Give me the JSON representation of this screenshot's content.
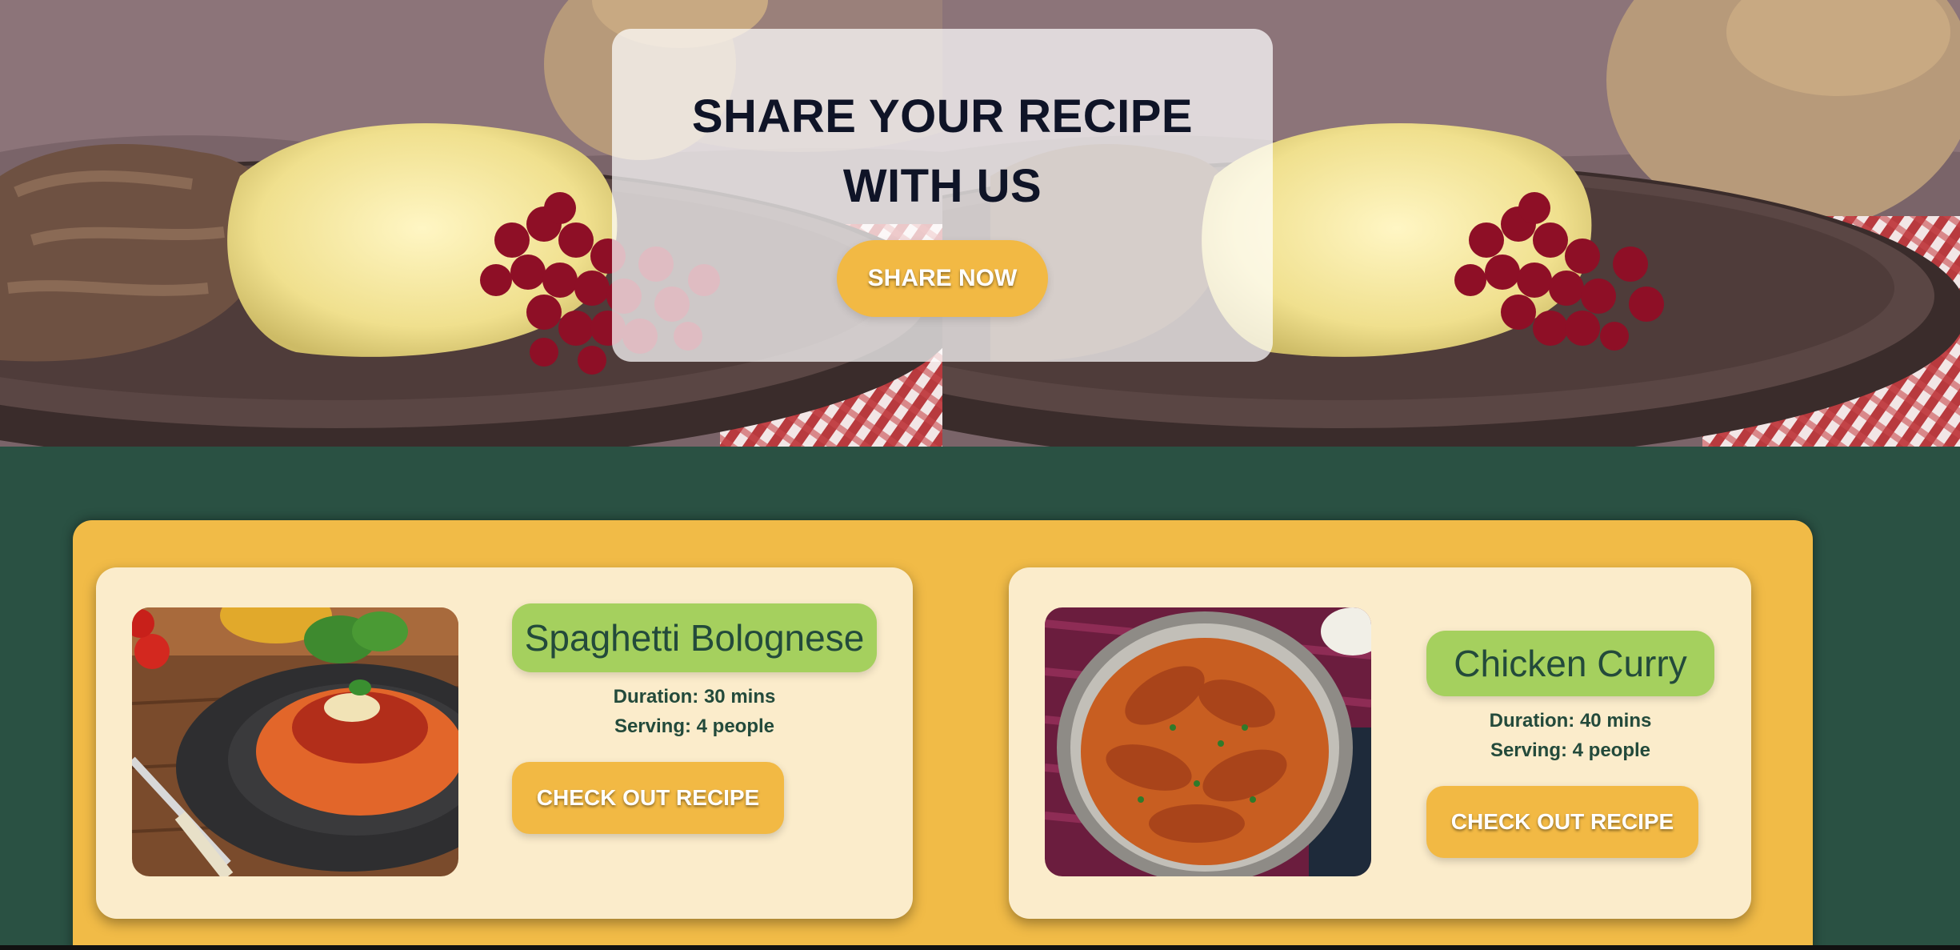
{
  "hero": {
    "title": "SHARE YOUR RECIPE WITH US",
    "share_button": "SHARE NOW",
    "image": "mashed-potatoes-meat-lingonberries-photo"
  },
  "recipes": [
    {
      "name": "Spaghetti Bolognese",
      "duration": "Duration: 30 mins",
      "serving": "Serving: 4 people",
      "button": "CHECK OUT RECIPE",
      "image": "spaghetti-bolognese-photo"
    },
    {
      "name": "Chicken Curry",
      "duration": "Duration: 40 mins",
      "serving": "Serving: 4 people",
      "button": "CHECK OUT RECIPE",
      "image": "chicken-curry-photo"
    }
  ],
  "colors": {
    "page_background": "#2a5143",
    "accent": "#f2b944",
    "card_background": "#fbeccb",
    "name_badge": "#a5d05e",
    "text_dark": "#234a3b"
  }
}
